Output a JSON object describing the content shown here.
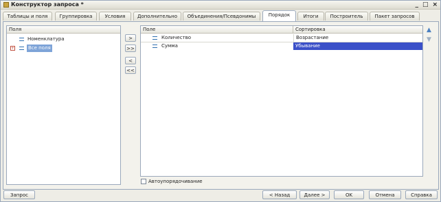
{
  "window": {
    "title": "Конструктор запроса *",
    "min_icon": "_",
    "max_icon": "□",
    "close_icon": "×"
  },
  "tabs": [
    {
      "label": "Таблицы и поля"
    },
    {
      "label": "Группировка"
    },
    {
      "label": "Условия"
    },
    {
      "label": "Дополнительно"
    },
    {
      "label": "Объединения/Псевдонимы"
    },
    {
      "label": "Порядок"
    },
    {
      "label": "Итоги"
    },
    {
      "label": "Построитель"
    },
    {
      "label": "Пакет запросов"
    }
  ],
  "left_panel": {
    "header": "Поля",
    "items": [
      {
        "label": "Номенклатура"
      },
      {
        "label": "Все поля"
      }
    ]
  },
  "transfer_buttons": [
    {
      "label": ">"
    },
    {
      "label": ">>"
    },
    {
      "label": "<"
    },
    {
      "label": "<<"
    }
  ],
  "right_panel": {
    "columns": [
      "Поле",
      "Сортировка"
    ],
    "rows": [
      {
        "field": "Количество",
        "sort": "Возрастание"
      },
      {
        "field": "Сумма",
        "sort": "Убывание"
      }
    ]
  },
  "move_buttons": {
    "up_icon": "▲",
    "down_icon": "▼"
  },
  "auto_order": {
    "label": "Автоупорядочивание",
    "checked": false
  },
  "bottom": {
    "query_button": "Запрос",
    "back_button": "< Назад",
    "next_button": "Далее >",
    "ok_button": "OK",
    "cancel_button": "Отмена",
    "help_button": "Справка"
  },
  "colors": {
    "selection": "#3b50c8",
    "border": "#9aa8bb",
    "background": "#eeede6"
  }
}
